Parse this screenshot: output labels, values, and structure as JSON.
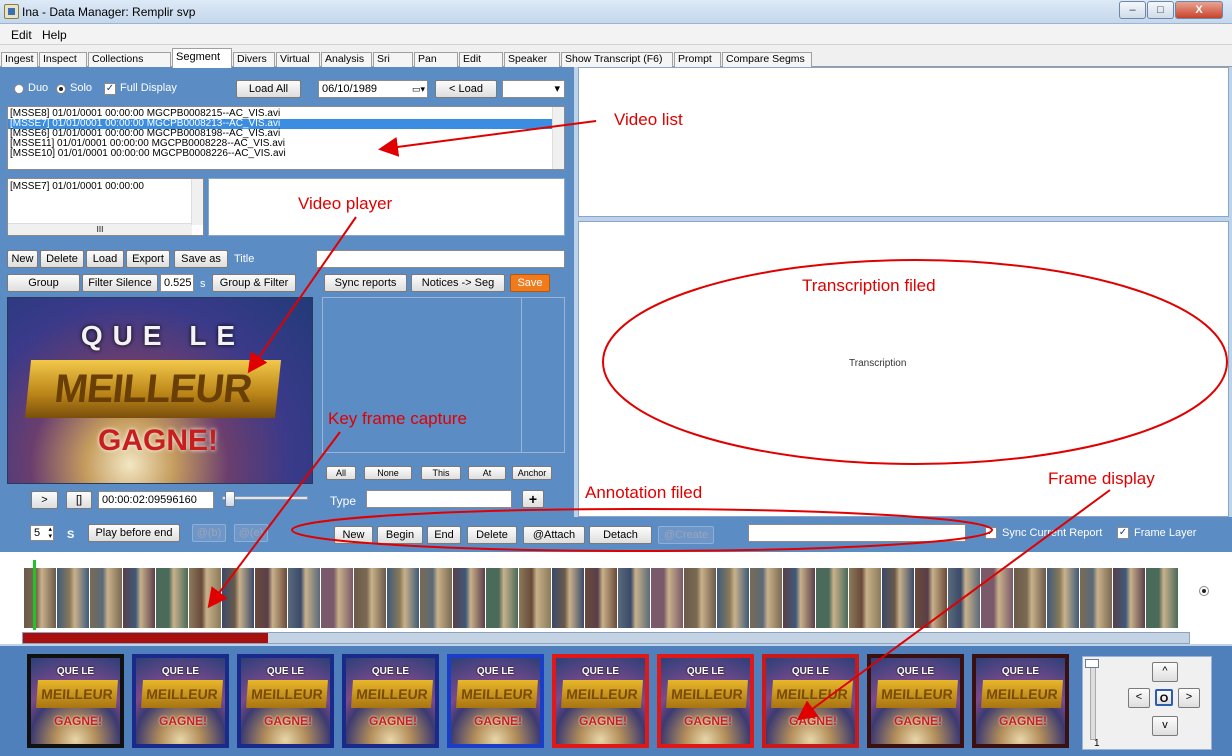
{
  "window": {
    "title": "Ina - Data Manager: Remplir svp",
    "min": "‒",
    "max": "□",
    "close": "X"
  },
  "menu": [
    "Edit",
    "Help"
  ],
  "tabs": [
    "Ingest",
    "Inspect",
    "Collections",
    "Segment",
    "Divers",
    "Virtual",
    "Analysis",
    "Sri",
    "Pan",
    "Edit",
    "Speaker",
    "Show Transcript (F6)",
    "Prompt",
    "Compare Segms"
  ],
  "active_tab": "Segment",
  "top_controls": {
    "duo": "Duo",
    "solo": "Solo",
    "full_display": "Full Display",
    "load_all": "Load All",
    "date": "06/10/1989",
    "load_prev": "< Load"
  },
  "video_list": [
    "[MSSE8] 01/01/0001 00:00:00 MGCPB0008215--AC_VIS.avi",
    "[MSSE7] 01/01/0001 00:00:00 MGCPB0008213--AC_VIS.avi",
    "[MSSE6] 01/01/0001 00:00:00 MGCPB0008198--AC_VIS.avi",
    "[MSSE11] 01/01/0001 00:00:00 MGCPB0008228--AC_VIS.avi",
    "[MSSE10] 01/01/0001 00:00:00 MGCPB0008226--AC_VIS.avi"
  ],
  "selected_list": "[MSSE7] 01/01/0001 00:00:00",
  "hscroll": "III",
  "row_buttons": {
    "new": "New",
    "delete": "Delete",
    "load": "Load",
    "export": "Export",
    "save_as": "Save as",
    "title": "Title"
  },
  "row_buttons2": {
    "group": "Group",
    "filter_silence": "Filter Silence",
    "silence_value": "0.525",
    "unit": "s",
    "group_filter": "Group & Filter"
  },
  "sync_buttons": {
    "sync_reports": "Sync reports",
    "notices_seg": "Notices -> Seg",
    "save": "Save"
  },
  "video_frame": {
    "line1": "QUE LE",
    "line2": "MEILLEUR",
    "line3": "GAGNE!"
  },
  "player": {
    "play": ">",
    "stop": "[]",
    "timecode": "00:00:02:09596160",
    "position": 0.04
  },
  "filter_buttons": [
    "All",
    "None",
    "This",
    "At",
    "Anchor"
  ],
  "type_label": "Type",
  "plus": "+",
  "transcription_placeholder": "Transcription",
  "bottom_bar": {
    "spin_value": "5",
    "s_label": "S",
    "play_before_end": "Play before end",
    "at_b": "@(b)",
    "at_e": "@(e)",
    "new": "New",
    "begin": "Begin",
    "end": "End",
    "delete": "Delete",
    "attach": "@Attach",
    "detach": "Detach",
    "create": "@Create",
    "sync_current_report": "Sync Current Report",
    "frame_layer": "Frame Layer"
  },
  "progress": 0.21,
  "keyframe_borders": [
    "#111111",
    "#1a2a8a",
    "#1a2a8a",
    "#1a2a8a",
    "#1a3ec8",
    "#e01818",
    "#e01818",
    "#c81a1a",
    "#3a1010",
    "#3a1010"
  ],
  "nav": {
    "up": "^",
    "left": "<",
    "center": "O",
    "right": ">",
    "down": "v",
    "slider_value": "1"
  },
  "annotations": {
    "video_list": "Video list",
    "video_player": "Video player",
    "transcription": "Transcription filed",
    "key_frame": "Key frame capture",
    "annotation": "Annotation filed",
    "frame_display": "Frame display"
  },
  "colors": {
    "panel": "#5b8cc4",
    "annotation": "#e00000",
    "save": "#f07b1c"
  }
}
